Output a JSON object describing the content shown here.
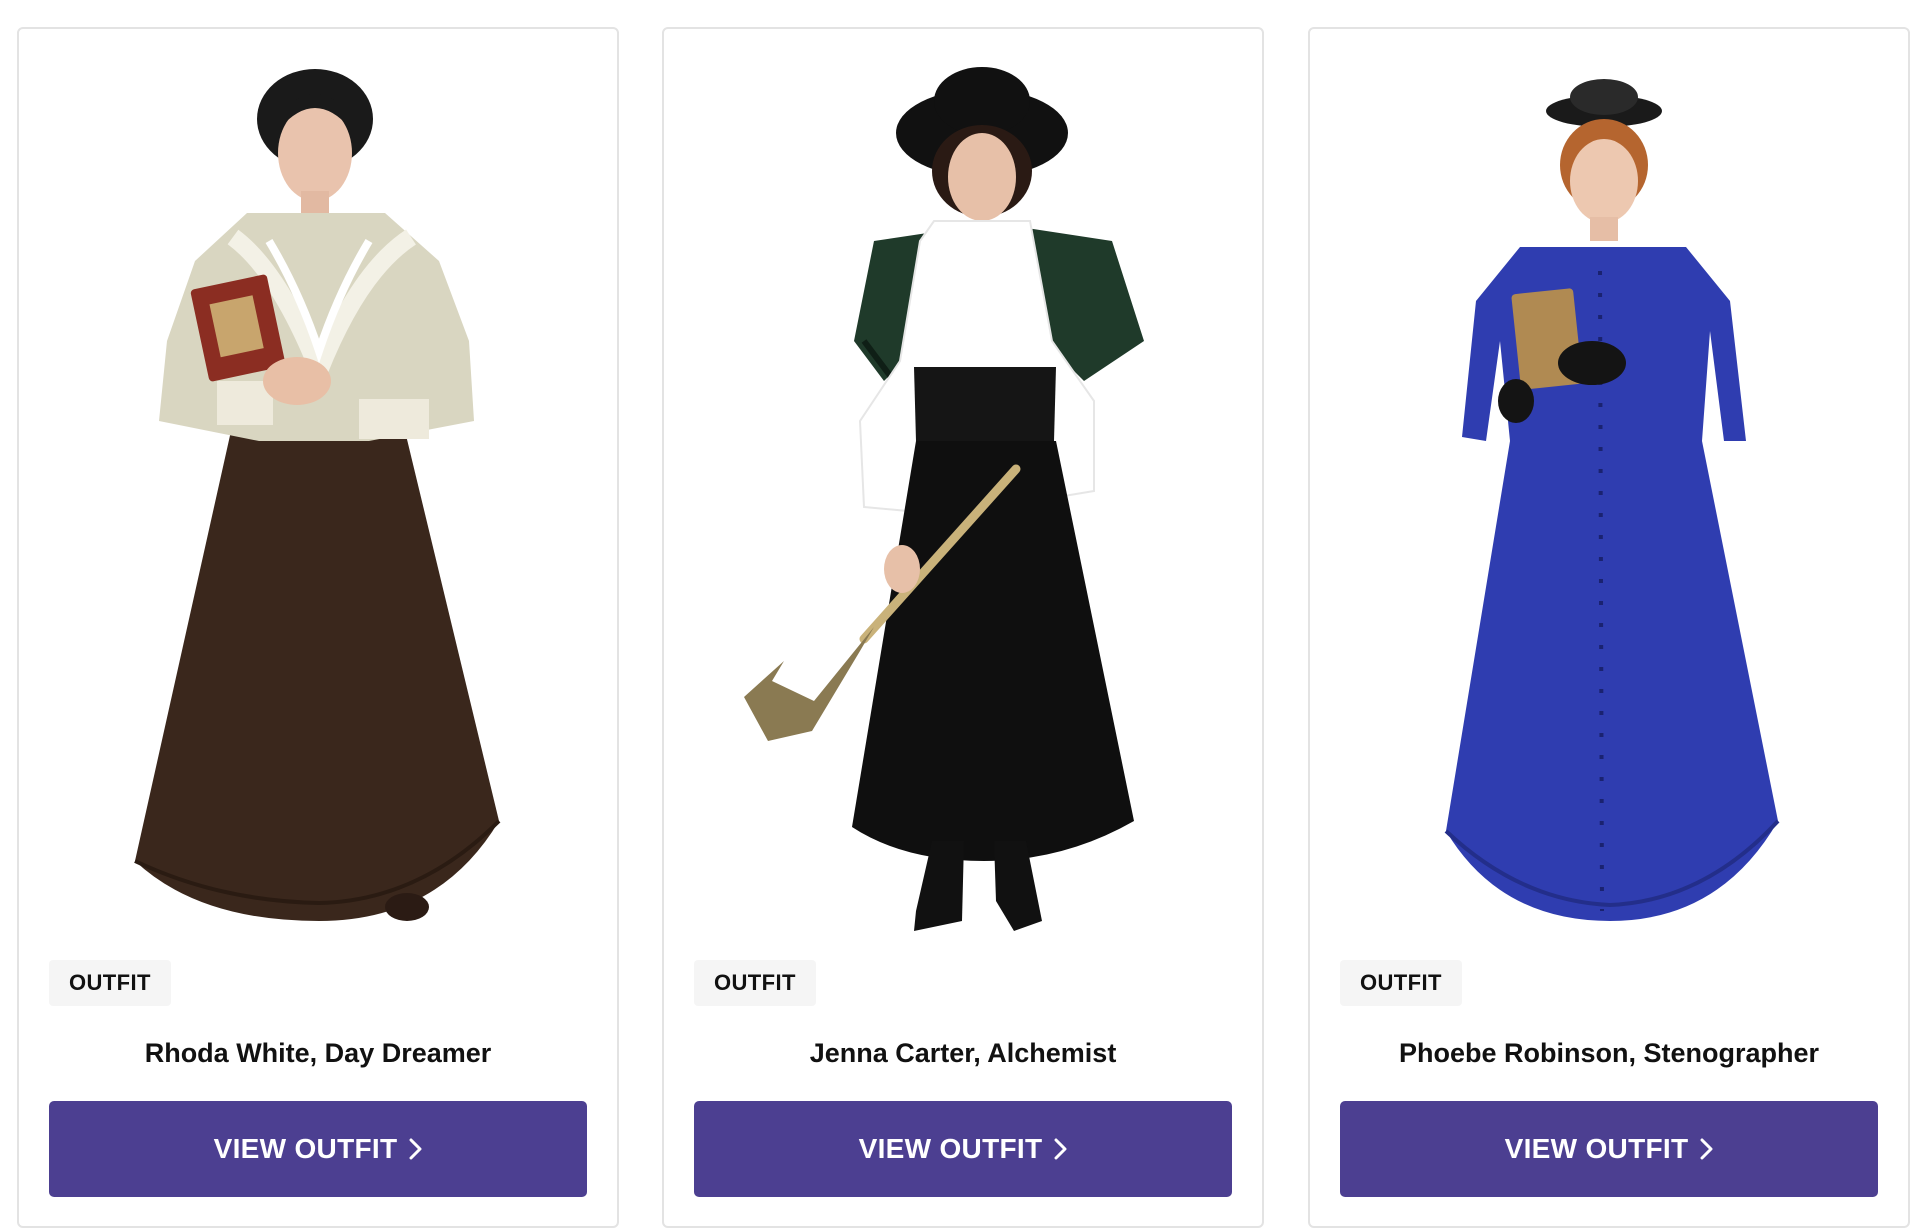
{
  "theme": {
    "button_color": "#4c3f91",
    "badge_background": "#f5f5f5",
    "card_border": "#e3e3e3"
  },
  "products": [
    {
      "badge": "OUTFIT",
      "title": "Rhoda White, Day Dreamer",
      "button_label": "VIEW OUTFIT",
      "button_icon": "chevron-right-icon",
      "image": "product-photo"
    },
    {
      "badge": "OUTFIT",
      "title": "Jenna Carter, Alchemist",
      "button_label": "VIEW OUTFIT",
      "button_icon": "chevron-right-icon",
      "image": "product-photo"
    },
    {
      "badge": "OUTFIT",
      "title": "Phoebe Robinson, Stenographer",
      "button_label": "VIEW OUTFIT",
      "button_icon": "chevron-right-icon",
      "image": "product-photo"
    }
  ]
}
